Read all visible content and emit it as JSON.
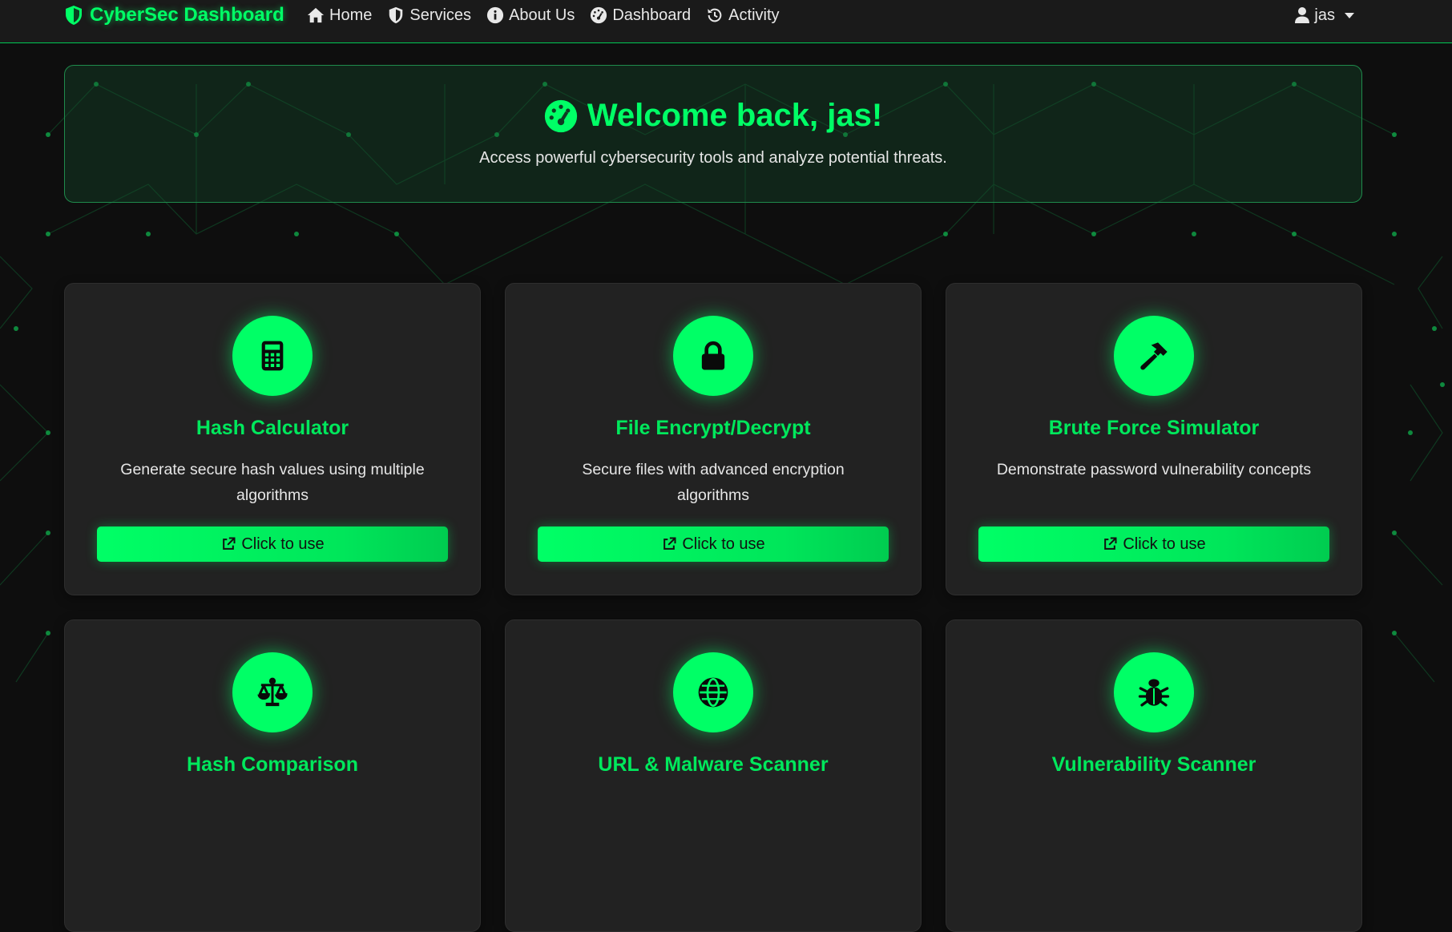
{
  "colors": {
    "accent": "#00ff66",
    "background": "#0e0e0e",
    "card": "#222222",
    "navbar": "#1a1a1a"
  },
  "navbar": {
    "brand": "CyberSec Dashboard",
    "brand_icon": "shield-icon",
    "links": [
      {
        "label": "Home",
        "icon": "home-icon"
      },
      {
        "label": "Services",
        "icon": "shield-icon"
      },
      {
        "label": "About Us",
        "icon": "info-icon"
      },
      {
        "label": "Dashboard",
        "icon": "gauge-icon"
      },
      {
        "label": "Activity",
        "icon": "history-icon"
      }
    ],
    "user": {
      "name": "jas",
      "icon": "user-icon"
    }
  },
  "welcome": {
    "title": "Welcome back, jas!",
    "icon": "gauge-icon",
    "subtitle": "Access powerful cybersecurity tools and analyze potential threats."
  },
  "cards": [
    {
      "title": "Hash Calculator",
      "description": "Generate secure hash values using multiple algorithms",
      "button": "Click to use",
      "icon": "calculator-icon"
    },
    {
      "title": "File Encrypt/Decrypt",
      "description": "Secure files with advanced encryption algorithms",
      "button": "Click to use",
      "icon": "lock-icon"
    },
    {
      "title": "Brute Force Simulator",
      "description": "Demonstrate password vulnerability concepts",
      "button": "Click to use",
      "icon": "hammer-icon"
    },
    {
      "title": "Hash Comparison",
      "description": "",
      "button": "",
      "icon": "scale-icon"
    },
    {
      "title": "URL & Malware Scanner",
      "description": "",
      "button": "",
      "icon": "globe-icon"
    },
    {
      "title": "Vulnerability Scanner",
      "description": "",
      "button": "",
      "icon": "bug-icon"
    }
  ]
}
